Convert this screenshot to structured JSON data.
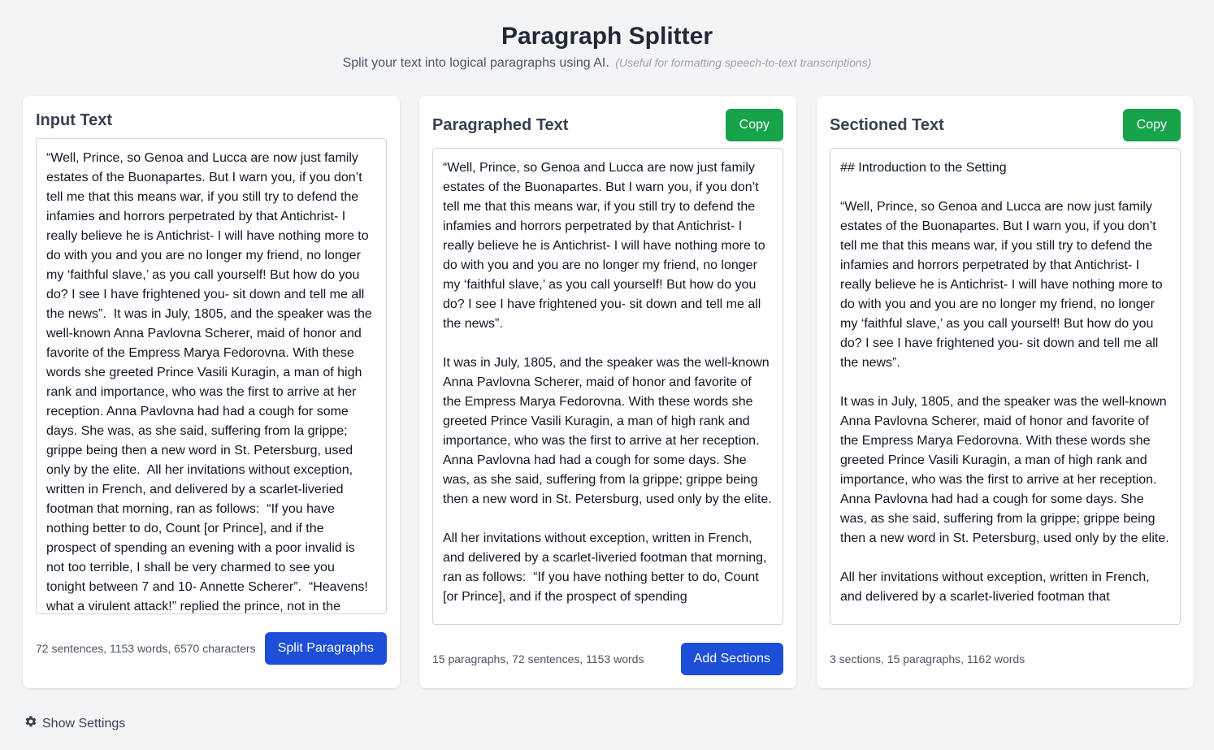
{
  "header": {
    "title": "Paragraph Splitter",
    "subtitle": "Split your text into logical paragraphs using AI.",
    "subtitle_note": "(Useful for formatting speech-to-text transcriptions)"
  },
  "input": {
    "title": "Input Text",
    "text": "“Well, Prince, so Genoa and Lucca are now just family estates of the Buonapartes. But I warn you, if you don’t tell me that this means war, if you still try to defend the infamies and horrors perpetrated by that Antichrist- I really believe he is Antichrist- I will have nothing more to do with you and you are no longer my friend, no longer my ‘faithful slave,’ as you call yourself! But how do you do? I see I have frightened you- sit down and tell me all the news”.  It was in July, 1805, and the speaker was the well-known Anna Pavlovna Scherer, maid of honor and favorite of the Empress Marya Fedorovna. With these words she greeted Prince Vasili Kuragin, a man of high rank and importance, who was the first to arrive at her reception. Anna Pavlovna had had a cough for some days. She was, as she said, suffering from la grippe; grippe being then a new word in St. Petersburg, used only by the elite.  All her invitations without exception, written in French, and delivered by a scarlet-liveried footman that morning, ran as follows:  “If you have nothing better to do, Count [or Prince], and if the prospect of spending an evening with a poor invalid is not too terrible, I shall be very charmed to see you tonight between 7 and 10- Annette Scherer”.  “Heavens! what a virulent attack!” replied the prince, not in the",
    "stats": "72 sentences, 1153 words, 6570 characters",
    "button": "Split Paragraphs"
  },
  "paragraphed": {
    "title": "Paragraphed Text",
    "copy_button": "Copy",
    "text": "“Well, Prince, so Genoa and Lucca are now just family estates of the Buonapartes. But I warn you, if you don’t tell me that this means war, if you still try to defend the infamies and horrors perpetrated by that Antichrist- I really believe he is Antichrist- I will have nothing more to do with you and you are no longer my friend, no longer my ‘faithful slave,’ as you call yourself! But how do you do? I see I have frightened you- sit down and tell me all the news”.\n\nIt was in July, 1805, and the speaker was the well-known Anna Pavlovna Scherer, maid of honor and favorite of the Empress Marya Fedorovna. With these words she greeted Prince Vasili Kuragin, a man of high rank and importance, who was the first to arrive at her reception. Anna Pavlovna had had a cough for some days. She was, as she said, suffering from la grippe; grippe being then a new word in St. Petersburg, used only by the elite.\n\nAll her invitations without exception, written in French, and delivered by a scarlet-liveried footman that morning, ran as follows:  “If you have nothing better to do, Count [or Prince], and if the prospect of spending",
    "stats": "15 paragraphs, 72 sentences, 1153 words",
    "button": "Add Sections"
  },
  "sectioned": {
    "title": "Sectioned Text",
    "copy_button": "Copy",
    "text": "## Introduction to the Setting\n\n“Well, Prince, so Genoa and Lucca are now just family estates of the Buonapartes. But I warn you, if you don’t tell me that this means war, if you still try to defend the infamies and horrors perpetrated by that Antichrist- I really believe he is Antichrist- I will have nothing more to do with you and you are no longer my friend, no longer my ‘faithful slave,’ as you call yourself! But how do you do? I see I have frightened you- sit down and tell me all the news”.\n\nIt was in July, 1805, and the speaker was the well-known Anna Pavlovna Scherer, maid of honor and favorite of the Empress Marya Fedorovna. With these words she greeted Prince Vasili Kuragin, a man of high rank and importance, who was the first to arrive at her reception. Anna Pavlovna had had a cough for some days. She was, as she said, suffering from la grippe; grippe being then a new word in St. Petersburg, used only by the elite.\n\nAll her invitations without exception, written in French, and delivered by a scarlet-liveried footman that",
    "stats": "3 sections, 15 paragraphs, 1162 words"
  },
  "settings": {
    "label": "Show Settings",
    "icon": "gear-icon"
  },
  "colors": {
    "primary_blue": "#1d4ed8",
    "copy_green": "#16a34a",
    "background": "#f3f4f6"
  }
}
